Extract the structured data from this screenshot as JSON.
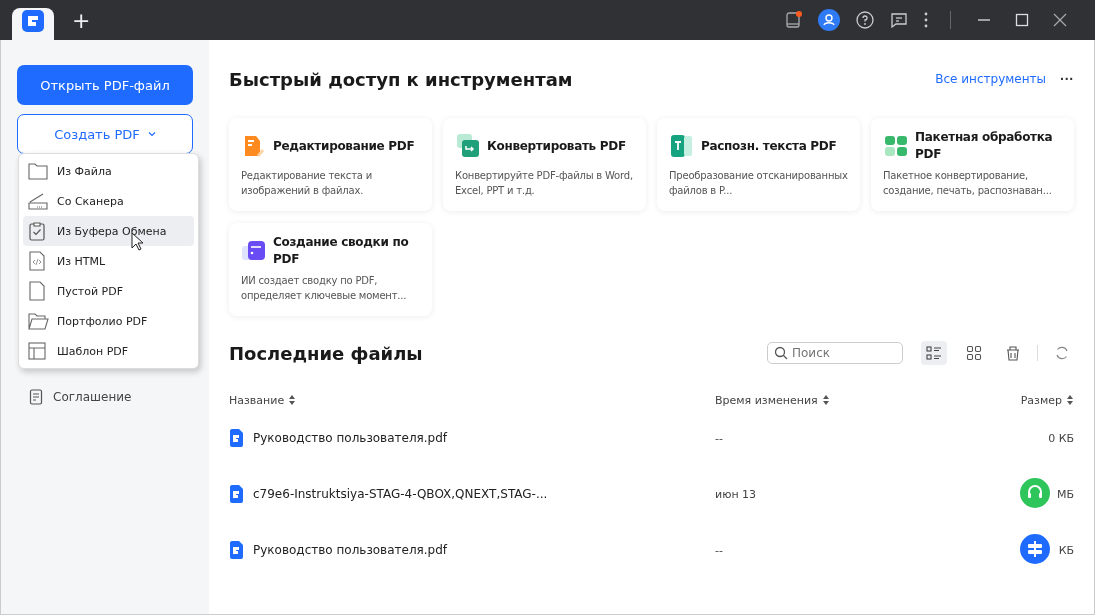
{
  "titlebar": {
    "new_tab": "+"
  },
  "sidebar": {
    "open_button": "Открыть PDF-файл",
    "create_button": "Создать PDF",
    "items": [
      {
        "label": "Соглашение"
      }
    ]
  },
  "create_menu": {
    "items": [
      {
        "kind": "file",
        "label": "Из Файла",
        "selected": false
      },
      {
        "kind": "scanner",
        "label": "Со Сканера",
        "selected": false
      },
      {
        "kind": "clipboard",
        "label": "Из Буфера Обмена",
        "selected": true
      },
      {
        "kind": "html",
        "label": "Из HTML",
        "selected": false
      },
      {
        "kind": "blank",
        "label": "Пустой PDF",
        "selected": false
      },
      {
        "kind": "portfolio",
        "label": "Портфолио PDF",
        "selected": false
      },
      {
        "kind": "template",
        "label": "Шаблон PDF",
        "selected": false
      }
    ]
  },
  "tools": {
    "title": "Быстрый доступ к инструментам",
    "all_link": "Все инструменты",
    "more": "···",
    "cards": [
      {
        "kind": "edit",
        "title": "Редактирование PDF",
        "description": "Редактирование текста и изображений в файлах."
      },
      {
        "kind": "convert",
        "title": "Конвертировать PDF",
        "description": "Конвертируйте PDF-файлы в Word, Excel, PPT и т.д."
      },
      {
        "kind": "ocr",
        "title": "Распозн. текста PDF",
        "description": "Преобразование отсканированных файлов в P..."
      },
      {
        "kind": "batch",
        "title": "Пакетная обработка PDF",
        "description": "Пакетное конвертирование, создание, печать, распознаван..."
      },
      {
        "kind": "summary",
        "title": "Создание сводки по PDF",
        "description": "ИИ создает сводку по PDF, определяет ключевые момент..."
      }
    ]
  },
  "recent": {
    "title": "Последние файлы",
    "search": {
      "placeholder": "Поиск"
    },
    "views": [
      {
        "kind": "list",
        "selected": true
      },
      {
        "kind": "grid",
        "selected": false
      }
    ],
    "columns": [
      "Название",
      "Время изменения",
      "Размер"
    ],
    "rows": [
      {
        "name": "Руководство пользователя.pdf",
        "modified": "--",
        "size": "0 КБ"
      },
      {
        "name": "c79e6-Instruktsiya-STAG-4-QBOX,QNEXT,STAG-...",
        "modified": "июн 13",
        "size": "МБ"
      },
      {
        "name": "Руководство пользователя.pdf",
        "modified": "--",
        "size": "КБ"
      }
    ]
  }
}
